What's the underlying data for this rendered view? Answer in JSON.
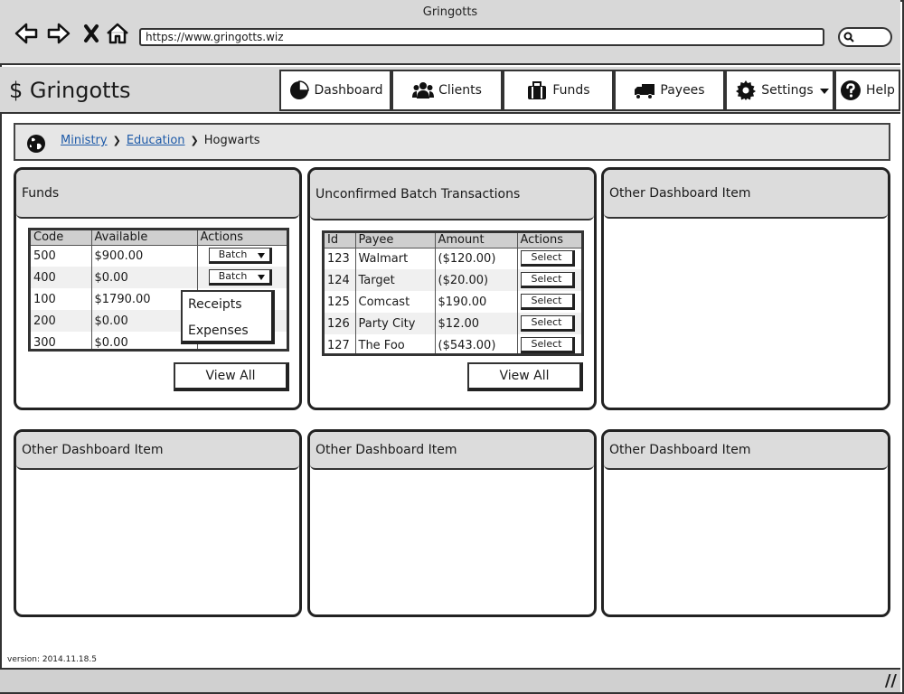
{
  "window": {
    "title": "Gringotts",
    "url": "https://www.gringotts.wiz"
  },
  "brand": {
    "symbol": "$",
    "name": "Gringotts"
  },
  "nav": [
    {
      "label": "Dashboard",
      "icon": "pie-chart-icon"
    },
    {
      "label": "Clients",
      "icon": "users-icon"
    },
    {
      "label": "Funds",
      "icon": "briefcase-icon"
    },
    {
      "label": "Payees",
      "icon": "truck-icon"
    },
    {
      "label": "Settings",
      "icon": "gear-icon"
    },
    {
      "label": "Help",
      "icon": "help-icon"
    }
  ],
  "breadcrumb": {
    "items": [
      "Ministry",
      "Education"
    ],
    "current": "Hogwarts"
  },
  "funds": {
    "title": "Funds",
    "columns": [
      "Code",
      "Available",
      "Actions"
    ],
    "rows": [
      {
        "code": "500",
        "available": "$900.00",
        "action": "Batch"
      },
      {
        "code": "400",
        "available": "$0.00",
        "action": "Batch"
      },
      {
        "code": "100",
        "available": "$1790.00",
        "action": ""
      },
      {
        "code": "200",
        "available": "$0.00",
        "action": ""
      },
      {
        "code": "300",
        "available": "$0.00",
        "action": ""
      }
    ],
    "menu": [
      "Receipts",
      "Expenses"
    ],
    "view_all": "View All"
  },
  "batch": {
    "title": "Unconfirmed Batch Transactions",
    "columns": [
      "Id",
      "Payee",
      "Amount",
      "Actions"
    ],
    "rows": [
      {
        "id": "123",
        "payee": "Walmart",
        "amount": "($120.00)",
        "action": "Select"
      },
      {
        "id": "124",
        "payee": "Target",
        "amount": "($20.00)",
        "action": "Select"
      },
      {
        "id": "125",
        "payee": "Comcast",
        "amount": "$190.00",
        "action": "Select"
      },
      {
        "id": "126",
        "payee": "Party City",
        "amount": "$12.00",
        "action": "Select"
      },
      {
        "id": "127",
        "payee": "The Foo",
        "amount": "($543.00)",
        "action": "Select"
      }
    ],
    "view_all": "View All"
  },
  "other": [
    "Other Dashboard Item",
    "Other Dashboard Item",
    "Other Dashboard Item",
    "Other Dashboard Item"
  ],
  "footer": {
    "version": "version: 2014.11.18.5"
  }
}
